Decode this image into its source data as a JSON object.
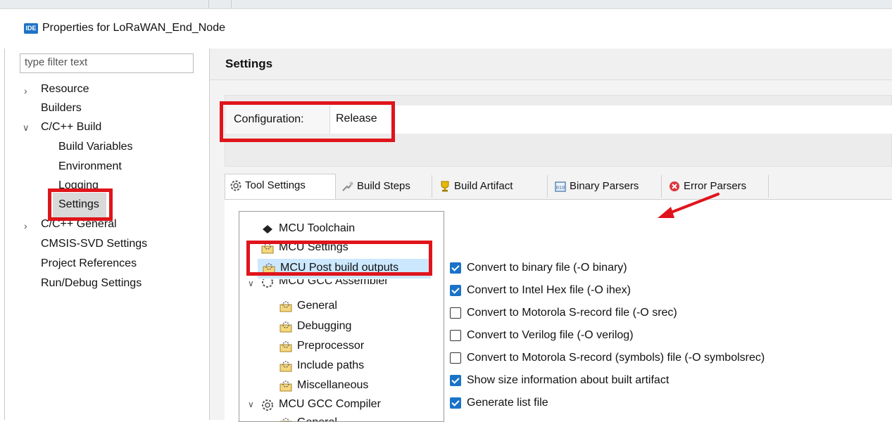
{
  "window": {
    "badge": "IDE",
    "title": "Properties for LoRaWAN_End_Node"
  },
  "left_panel": {
    "filter_placeholder": "type filter text",
    "items": [
      {
        "label": "Resource"
      },
      {
        "label": "Builders"
      },
      {
        "label": "C/C++ Build"
      },
      {
        "label": "Build Variables"
      },
      {
        "label": "Environment"
      },
      {
        "label": "Logging"
      },
      {
        "label": "Settings"
      },
      {
        "label": "C/C++ General"
      },
      {
        "label": "CMSIS-SVD Settings"
      },
      {
        "label": "Project References"
      },
      {
        "label": "Run/Debug Settings"
      }
    ]
  },
  "main": {
    "title": "Settings",
    "configuration_label": "Configuration:",
    "configuration_value": "Release",
    "tabs": [
      {
        "label": "Tool Settings",
        "icon": "gear-icon"
      },
      {
        "label": "Build Steps",
        "icon": "steps-icon"
      },
      {
        "label": "Build Artifact",
        "icon": "trophy-icon"
      },
      {
        "label": "Binary Parsers",
        "icon": "binary-icon"
      },
      {
        "label": "Error Parsers",
        "icon": "error-icon"
      }
    ],
    "tool_tree": [
      {
        "label": "MCU Toolchain"
      },
      {
        "label": "MCU Settings"
      },
      {
        "label": "MCU Post build outputs"
      },
      {
        "label": "MCU GCC Assembler"
      },
      {
        "label": "General"
      },
      {
        "label": "Debugging"
      },
      {
        "label": "Preprocessor"
      },
      {
        "label": "Include paths"
      },
      {
        "label": "Miscellaneous"
      },
      {
        "label": "MCU GCC Compiler"
      },
      {
        "label": "General"
      }
    ],
    "options": [
      {
        "label": "Convert to binary file (-O binary)",
        "checked": true
      },
      {
        "label": "Convert to Intel Hex file (-O ihex)",
        "checked": true
      },
      {
        "label": "Convert to Motorola S-record file (-O srec)",
        "checked": false
      },
      {
        "label": "Convert to Verilog file (-O verilog)",
        "checked": false
      },
      {
        "label": "Convert to Motorola S-record (symbols) file (-O symbolsrec)",
        "checked": false
      },
      {
        "label": "Show size information about built artifact",
        "checked": true
      },
      {
        "label": "Generate list file",
        "checked": true
      }
    ]
  },
  "colors": {
    "highlight": "#e0141b",
    "accent": "#1a73c8",
    "selection": "#cce8ff"
  }
}
